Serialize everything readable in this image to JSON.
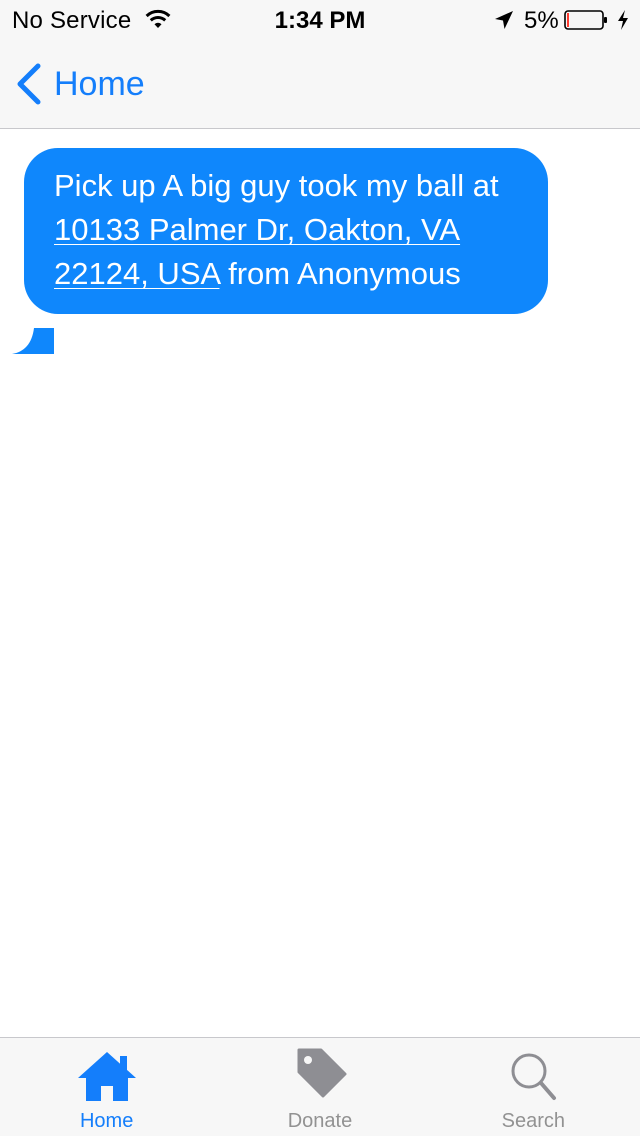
{
  "status_bar": {
    "carrier": "No Service",
    "time": "1:34 PM",
    "battery_percent": "5%",
    "battery_level": 0.05,
    "icons": [
      "wifi-icon",
      "location-arrow-icon",
      "battery-icon",
      "charging-bolt-icon"
    ]
  },
  "nav_bar": {
    "back_label": "Home",
    "back_icon": "chevron-left-icon"
  },
  "message": {
    "text_before": "Pick up A big guy took my ball at ",
    "address": "10133 Palmer Dr, Oakton, VA 22124, USA",
    "text_after": " from Anonymous"
  },
  "tab_bar": {
    "tabs": [
      {
        "label": "Home",
        "icon": "home-icon",
        "active": true
      },
      {
        "label": "Donate",
        "icon": "tag-icon",
        "active": false
      },
      {
        "label": "Search",
        "icon": "search-icon",
        "active": false
      }
    ]
  },
  "colors": {
    "accent": "#147efb",
    "bubble": "#0f87fc",
    "bar_background": "#f7f7f7",
    "inactive_tab": "#929292",
    "battery_low": "#ff3b30"
  }
}
